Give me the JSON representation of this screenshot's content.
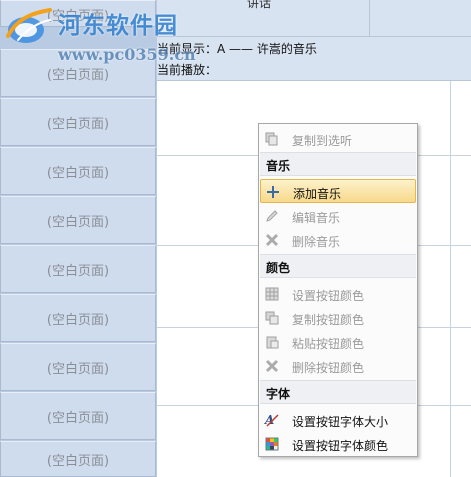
{
  "watermark": {
    "site_name": "河东软件园",
    "url": "www.pc0359.cn"
  },
  "header": {
    "top_cell_label": "讲话"
  },
  "status": {
    "display_label": "当前显示：",
    "display_value": "A —— 许嵩的音乐",
    "playing_label": "当前播放："
  },
  "left_pages": {
    "top_partial": "(空白页面)",
    "items": [
      "(空白页面)",
      "(空白页面)",
      "(空白页面)",
      "(空白页面)",
      "(空白页面)",
      "(空白页面)",
      "(空白页面)",
      "(空白页面)",
      "(空白页面)"
    ]
  },
  "context_menu": {
    "copy_to_listen": "复制到选听",
    "music_header": "音乐",
    "add_music": "添加音乐",
    "edit_music": "编辑音乐",
    "delete_music": "删除音乐",
    "color_header": "颜色",
    "set_button_color": "设置按钮颜色",
    "copy_button_color": "复制按钮颜色",
    "paste_button_color": "粘贴按钮颜色",
    "delete_button_color": "删除按钮颜色",
    "font_header": "字体",
    "set_font_size": "设置按钮字体大小",
    "set_font_color": "设置按钮字体颜色"
  },
  "colors": {
    "accent_highlight": "#f7d98b",
    "panel_blue": "#cfdcee",
    "watermark_blue": "#2f7fd0"
  }
}
